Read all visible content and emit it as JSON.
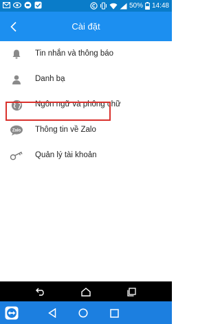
{
  "status_bar": {
    "battery_percent": "50%",
    "time": "14:48",
    "left_icons": [
      "mail-icon",
      "eye-icon",
      "zalo-notification-icon",
      "check-icon"
    ],
    "right_icons": [
      "copyright-icon",
      "vibrate-icon",
      "wifi-icon",
      "signal-icon",
      "battery-icon"
    ]
  },
  "app_bar": {
    "title": "Cài đặt",
    "back_icon": "chevron-left-icon",
    "background": "#1c8ff0"
  },
  "menu": {
    "items": [
      {
        "label": "Tin nhắn và thông báo",
        "icon": "bell-icon"
      },
      {
        "label": "Danh bạ",
        "icon": "person-icon"
      },
      {
        "label": "Ngôn ngữ và phông chữ",
        "icon": "globe-icon"
      },
      {
        "label": "Thông tin về Zalo",
        "icon": "zalo-icon"
      },
      {
        "label": "Quản lý tài khoản",
        "icon": "key-icon",
        "highlighted": true
      }
    ]
  },
  "highlight_color": "#d9302b",
  "system_nav": {
    "upper": [
      "back-arrow-icon",
      "home-icon",
      "recents-icon"
    ],
    "lower": [
      "teamviewer-icon",
      "back-triangle-icon",
      "home-circle-icon",
      "recents-square-icon"
    ]
  },
  "zalo_badge_text": "Zalo"
}
